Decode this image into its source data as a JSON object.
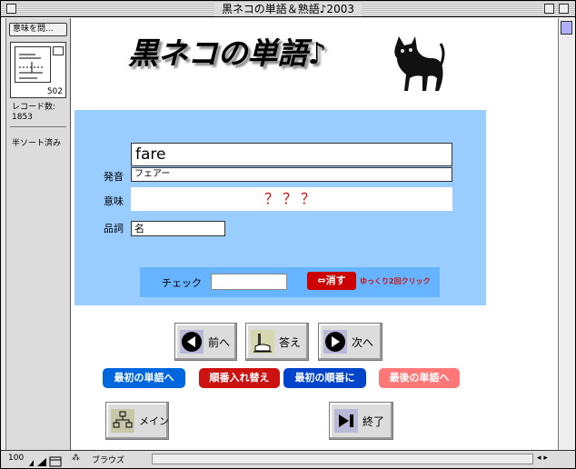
{
  "window": {
    "title": "黒ネコの単語＆熟語♪2003"
  },
  "sidebar": {
    "layout_button": "意味を問...",
    "book_number": "502",
    "record_label": "レコード数:",
    "record_count": "1853",
    "sort_status": "半ソート済み"
  },
  "bottombar": {
    "zoom": "100",
    "mode": "ブラウズ"
  },
  "header": {
    "title": "黒ネコの単語♪"
  },
  "card": {
    "word": "fare",
    "pronunciation_label": "発音",
    "pronunciation": "フェアー",
    "meaning_label": "意味",
    "meaning": "？？？",
    "pos_label": "品詞",
    "pos": "名",
    "check_label": "チェック",
    "check_value": "",
    "clear_button": "⇔消す",
    "clear_hint": "ゆっくり2回クリック"
  },
  "nav": {
    "prev": "前へ",
    "answer": "答え",
    "next": "次へ"
  },
  "actions": {
    "first_word": "最初の単語へ",
    "shuffle": "順番入れ替え",
    "first_order": "最初の順番に",
    "last_word": "最後の単語へ"
  },
  "footer": {
    "main": "メイン",
    "quit": "終了"
  },
  "colors": {
    "card_bg": "#99ccff",
    "check_bg": "#66b3ff",
    "accent_red": "#cc0000",
    "first_word_btn": "#0066dd",
    "shuffle_btn": "#cc1111",
    "first_order_btn": "#0044cc",
    "last_word_btn": "#ff7777"
  },
  "icons": {
    "prev": "left-arrow-circle-icon",
    "answer": "pencil-hand-icon",
    "next": "right-arrow-circle-icon",
    "main": "hierarchy-icon",
    "quit": "skip-end-icon",
    "cat": "black-cat-icon"
  }
}
